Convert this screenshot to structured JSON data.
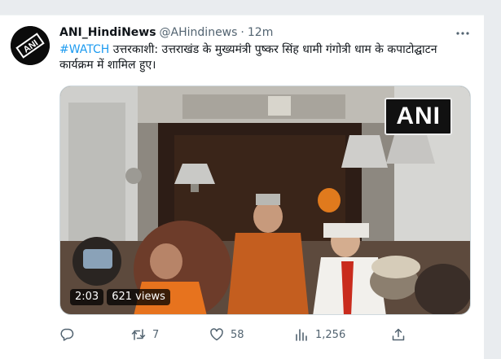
{
  "tweet": {
    "display_name": "ANI_HindiNews",
    "handle": "@AHindinews",
    "separator": "·",
    "time": "12m",
    "hashtag": "#WATCH",
    "body": " उत्तरकाशी: उत्तराखंड के मुख्यमंत्री पुष्कर सिंह धामी गंगोत्री धाम के कपाटोद्घाटन कार्यक्रम में शामिल हुए।",
    "avatar_text": "ANI"
  },
  "video": {
    "watermark": "ANI",
    "duration": "2:03",
    "views": "621 views"
  },
  "actions": {
    "reply_count": "",
    "retweet_count": "7",
    "like_count": "58",
    "analytics_count": "1,256",
    "share_count": ""
  },
  "colors": {
    "accent": "#1d9bf0",
    "secondary_text": "#536471",
    "primary_text": "#0f1419"
  },
  "icons": [
    "more-icon",
    "reply-icon",
    "retweet-icon",
    "like-icon",
    "analytics-icon",
    "share-icon"
  ]
}
